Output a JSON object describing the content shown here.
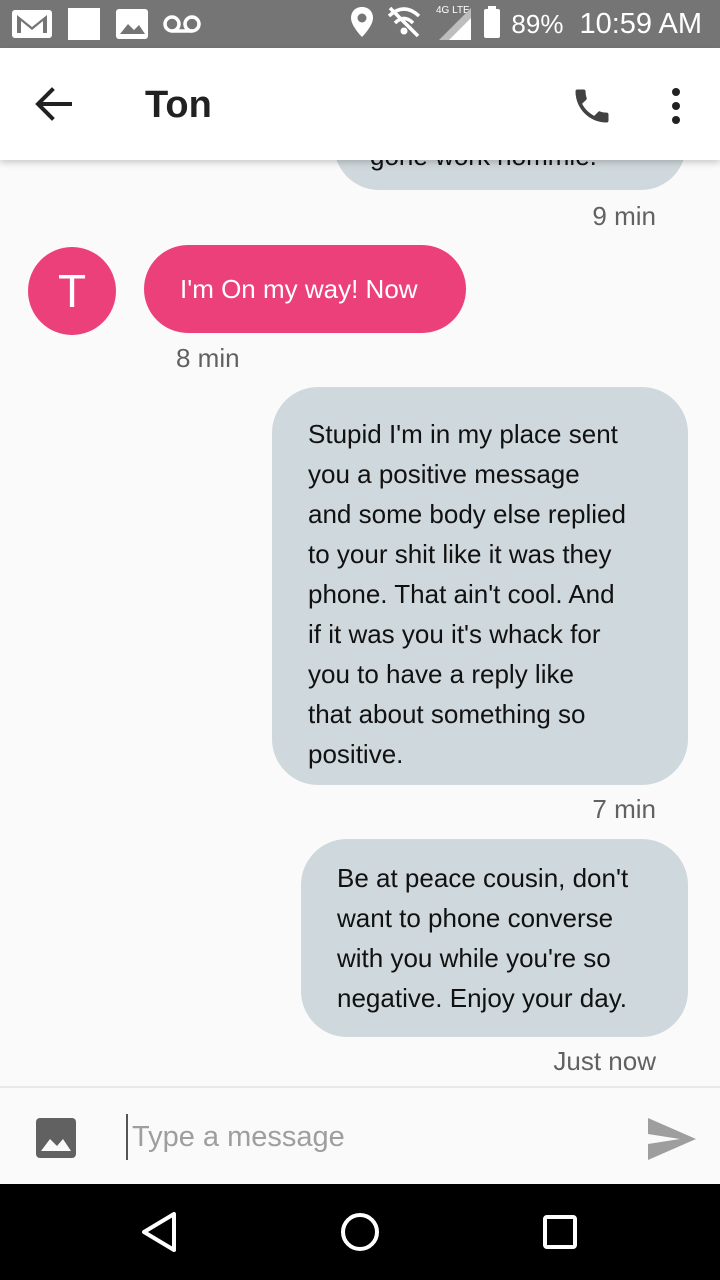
{
  "status_bar": {
    "icons_left": [
      "gmail-icon",
      "notification-square-icon",
      "image-icon",
      "voicemail-icon"
    ],
    "icons_right": [
      "location-icon",
      "no-signal-icon",
      "lte-signal-icon",
      "battery-icon"
    ],
    "network_label": "4G LTE",
    "battery": "89%",
    "time": "10:59 AM"
  },
  "app_bar": {
    "title": "Ton",
    "icons": [
      "back-arrow-icon",
      "phone-icon",
      "more-vert-icon"
    ]
  },
  "messages": [
    {
      "direction": "outgoing",
      "text": "gone work hommie.",
      "timestamp": "9 min",
      "partially_visible": true
    },
    {
      "direction": "incoming",
      "avatar_letter": "T",
      "text": "I'm On my way! Now",
      "timestamp": "8 min"
    },
    {
      "direction": "outgoing",
      "lines": [
        "Stupid I'm in my place sent",
        "you a positive message",
        "and some body else replied",
        "to your shit like it was they",
        "phone. That ain't cool. And",
        "if it was you it's whack for",
        "you to have a reply like",
        "that about something so",
        "positive."
      ],
      "timestamp": "7 min"
    },
    {
      "direction": "outgoing",
      "lines": [
        "Be at peace cousin, don't",
        "want to phone converse",
        "with you while you're so",
        "negative. Enjoy your day."
      ],
      "timestamp": "Just now"
    }
  ],
  "composer": {
    "placeholder": "Type a message",
    "value": "",
    "icons": [
      "attach-image-icon",
      "send-icon"
    ]
  },
  "nav_bar": {
    "icons": [
      "back-triangle-icon",
      "home-circle-icon",
      "recents-square-icon"
    ]
  },
  "colors": {
    "status_bar": "#757575",
    "incoming_bubble": "#ec407a",
    "outgoing_bubble": "#cfd8dc",
    "background": "#fafafa",
    "nav_bar": "#000000"
  }
}
